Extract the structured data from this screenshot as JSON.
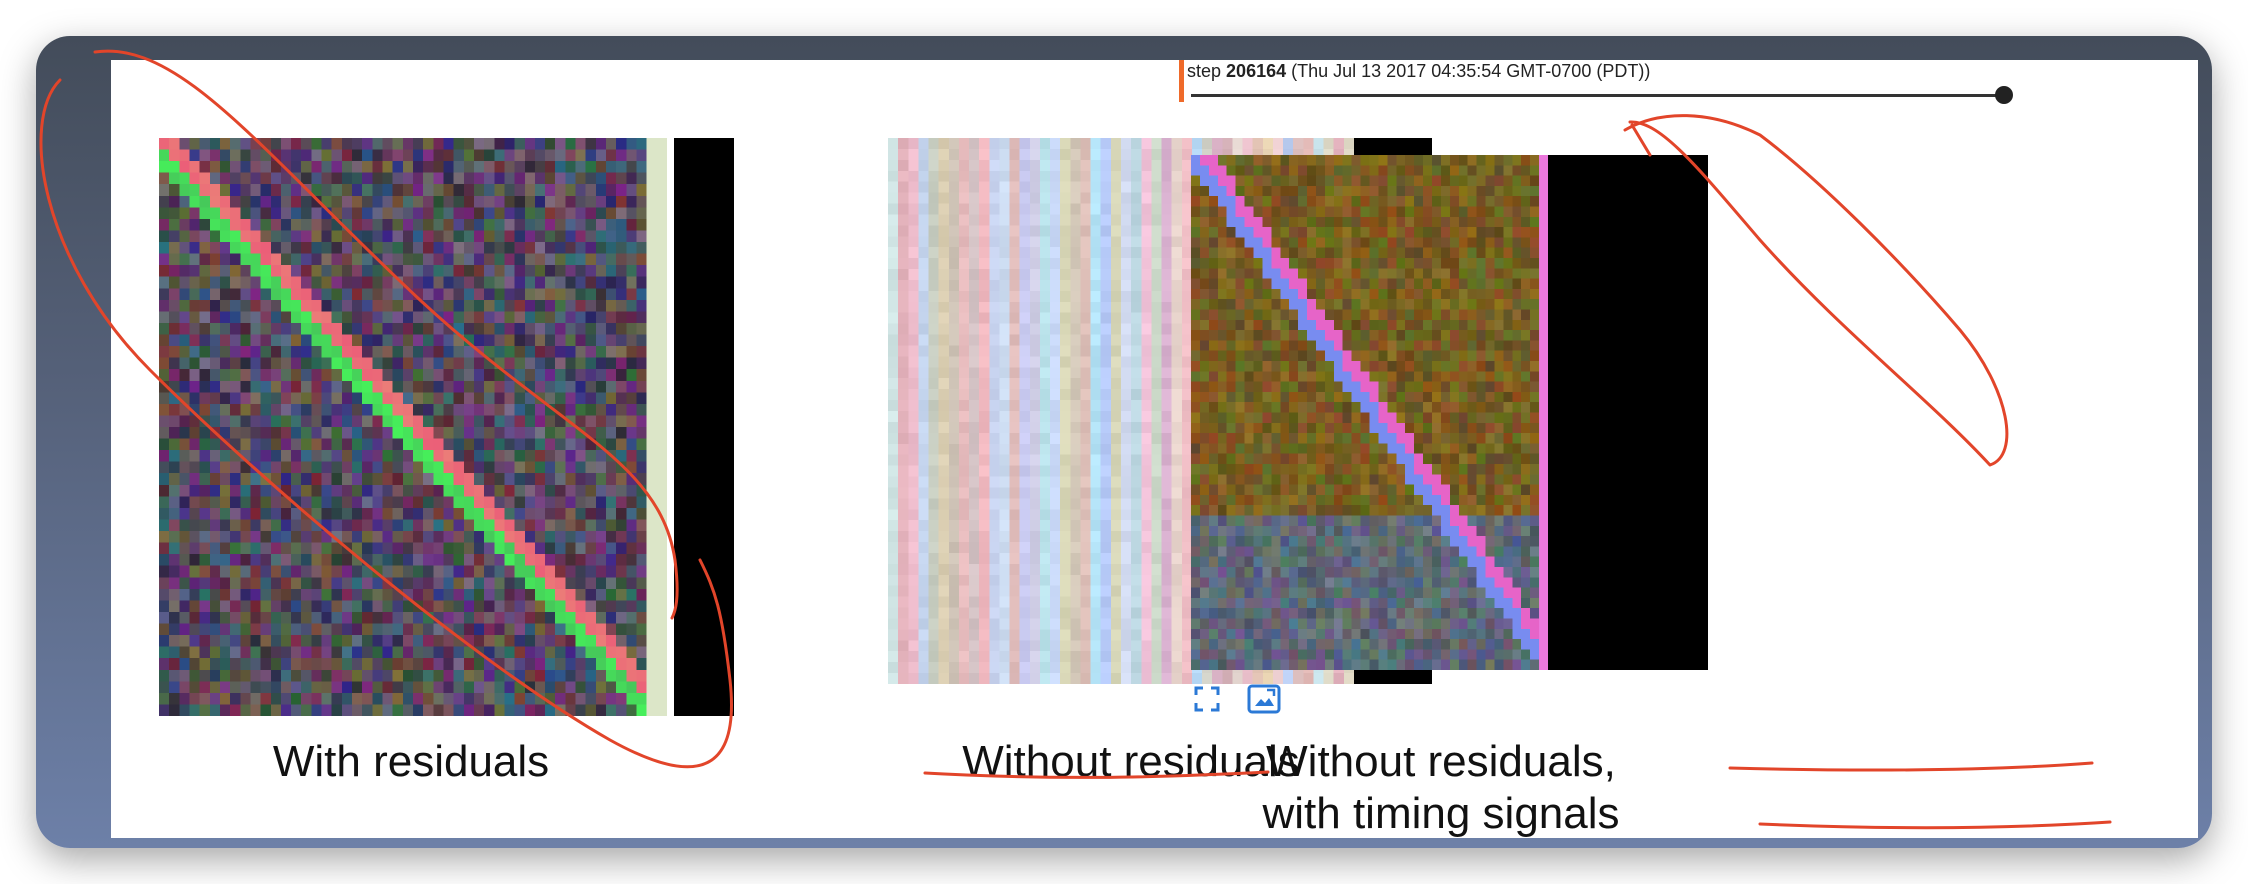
{
  "colors": {
    "annotation": "#e2452a",
    "accent_orange": "#ef6a2a",
    "icon_blue": "#2b79d6"
  },
  "panels": [
    {
      "caption": "With residuals"
    },
    {
      "caption": "Without residuals"
    },
    {
      "caption_line1": "Without residuals,",
      "caption_line2": "with timing signals"
    }
  ],
  "tensorboard": {
    "step_label": "step",
    "step_value": "206164",
    "step_time": "(Thu Jul 13 2017 04:35:54 GMT-0700 (PDT))",
    "icons": [
      "fullscreen-icon",
      "fit-image-icon"
    ]
  }
}
